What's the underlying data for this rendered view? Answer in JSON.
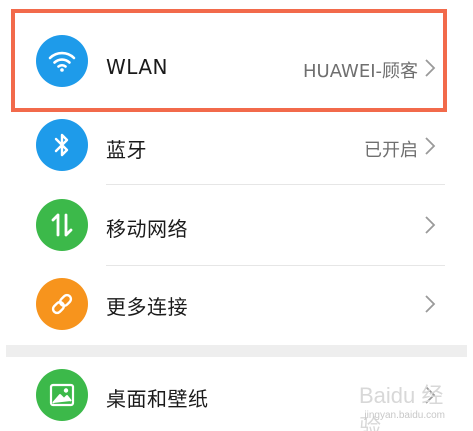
{
  "settings": {
    "items": [
      {
        "label": "WLAN",
        "value": "HUAWEI-顾客",
        "icon": "wifi-icon",
        "color": "#1e9bea"
      },
      {
        "label": "蓝牙",
        "value": "已开启",
        "icon": "bluetooth-icon",
        "color": "#1e9bea"
      },
      {
        "label": "移动网络",
        "value": "",
        "icon": "mobile-data-icon",
        "color": "#3cb94a"
      },
      {
        "label": "更多连接",
        "value": "",
        "icon": "link-icon",
        "color": "#f7941d"
      },
      {
        "label": "桌面和壁纸",
        "value": "",
        "icon": "image-icon",
        "color": "#3cb94a"
      }
    ]
  },
  "highlight_color": "#f26a4b",
  "watermark": {
    "brand": "Baidu 经验",
    "site": "jingyan.baidu.com"
  }
}
